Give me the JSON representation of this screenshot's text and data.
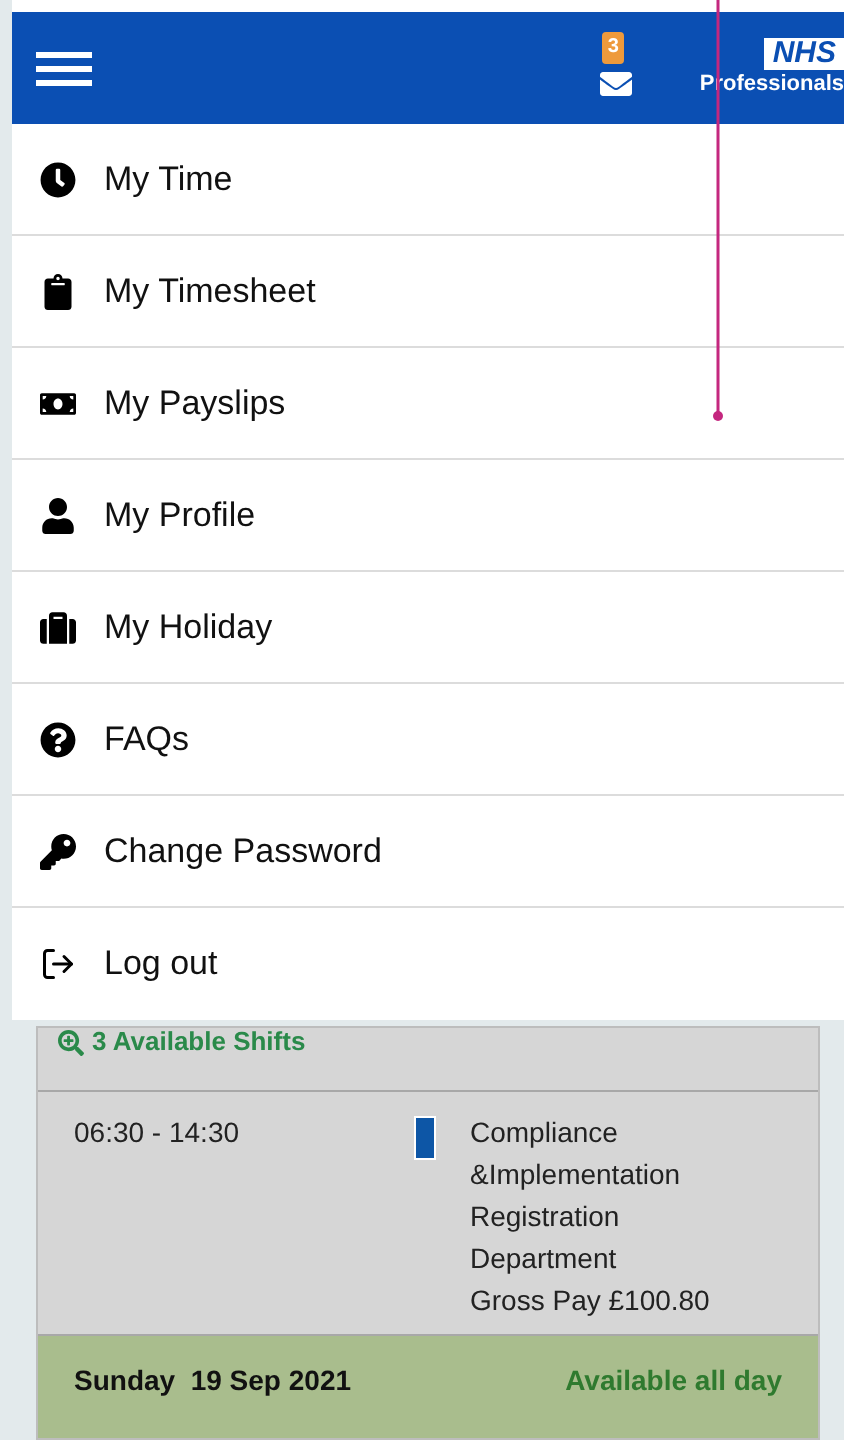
{
  "header": {
    "message_count": "3",
    "logo": {
      "mark": "NHS",
      "name": "Professionals"
    }
  },
  "menu": [
    {
      "label": "My Time"
    },
    {
      "label": "My Timesheet"
    },
    {
      "label": "My Payslips"
    },
    {
      "label": "My Profile"
    },
    {
      "label": "My Holiday"
    },
    {
      "label": "FAQs"
    },
    {
      "label": "Change Password"
    },
    {
      "label": "Log out"
    }
  ],
  "background": {
    "available_shifts": "3 Available Shifts",
    "shift": {
      "time": "06:30 - 14:30",
      "color": "#0d56a6",
      "details": [
        "Compliance",
        "&Implementation",
        "Registration",
        "Department",
        "Gross Pay £100.80"
      ]
    },
    "day": {
      "date": "Sunday  19 Sep 2021",
      "status": "Available all day"
    }
  }
}
